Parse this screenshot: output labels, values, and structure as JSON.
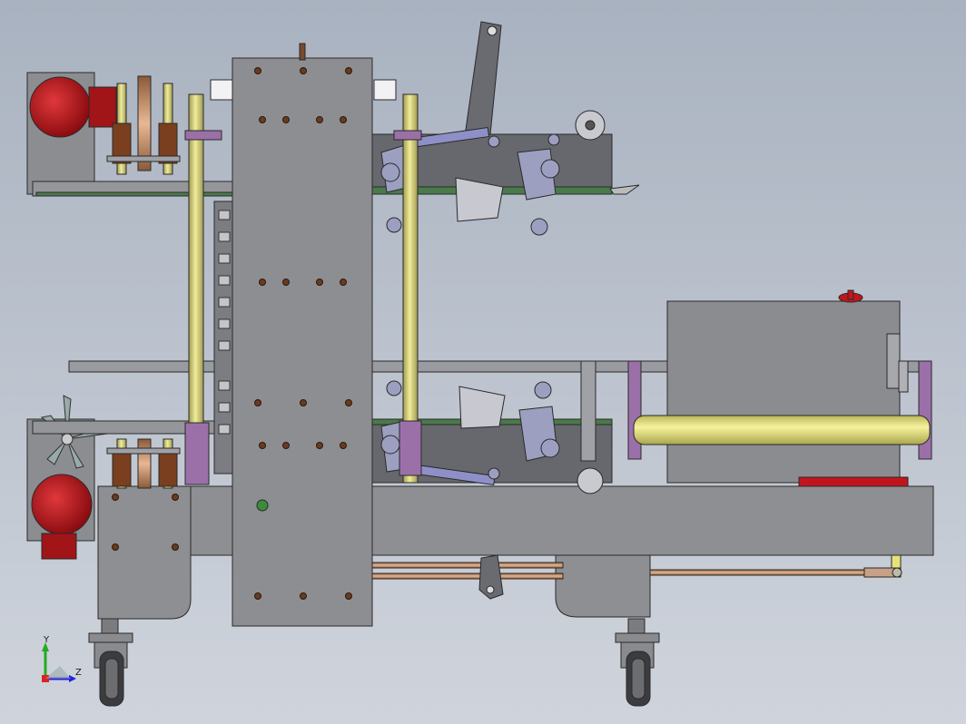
{
  "viewport": {
    "background_top": "#a9b2c0",
    "background_bottom": "#c9cfd8"
  },
  "triad": {
    "y_label": "Y",
    "z_label": "Z"
  },
  "colors": {
    "frame_fill": "#8f9094",
    "frame_stroke": "#2a2a2a",
    "panel_fill": "#898a8e",
    "motor_red": "#c2151b",
    "rod_yellow": "#e0dc8a",
    "roller_yellow": "#ecea80",
    "purple_bracket": "#9b70a8",
    "copper": "#c89470",
    "bolt_brown": "#6a3a22",
    "belt_green": "#4a7a4a",
    "dark_mech": "#5c5d62",
    "axis_red": "#d22",
    "axis_green": "#2a2",
    "axis_blue": "#22d"
  }
}
